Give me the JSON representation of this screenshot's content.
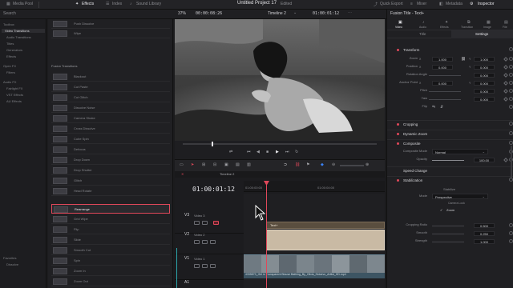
{
  "topbar": {
    "media_pool": "Media Pool",
    "effects": "Effects",
    "index": "Index",
    "sound_library": "Sound Library",
    "project_title": "Untitled Project 17",
    "edited": "Edited",
    "quick_export": "Quick Export",
    "mixer": "Mixer",
    "metadata": "Metadata",
    "inspector": "Inspector"
  },
  "viewer_bar": {
    "zoom": "37%",
    "source_tc": "00:00:08:26",
    "timeline_name": "Timeline 2",
    "record_tc": "01:00:01:12",
    "clip_name": "Fusion Title - Text+"
  },
  "left_panel": {
    "search_label": "Search",
    "items": [
      "Toolbox",
      "Video Transitions",
      "Audio Transitions",
      "Titles",
      "Generators",
      "Effects",
      "Open FX",
      "Filters",
      "Audio FX",
      "Fairlight FX",
      "VST Effects",
      "AU Effects",
      "Favorites",
      "Dissolve"
    ]
  },
  "effects_list": {
    "section_header": "Fusion Transitions",
    "items": [
      "Push Dissolve",
      "Wipe",
      "",
      "Fusion Transitions",
      "Blackout",
      "Cut Paste",
      "Cut Glitch",
      "Dissolve Noise",
      "Camera Shake",
      "Cross Dissolve",
      "Cube Spin",
      "Defocus",
      "Drop Down",
      "Drop Shutter",
      "Glitch",
      "Head Rotate",
      "Rearrange",
      "Grid Wipe",
      "Flip",
      "Slide",
      "Smooth Cut",
      "Spin",
      "Zoom In",
      "Zoom Out"
    ],
    "selected": "Rearrange"
  },
  "timeline": {
    "tab_label": "Timeline 2",
    "timecode": "01:00:01:12",
    "ruler_marks": [
      "01:00:00:00",
      "01:00:04:00"
    ],
    "tracks": [
      {
        "id": "V3",
        "name": "Video 3"
      },
      {
        "id": "V2",
        "name": "Video 2"
      },
      {
        "id": "V1",
        "name": "Video 1"
      },
      {
        "id": "A1",
        "name": "Audio 1"
      }
    ],
    "clips": {
      "v3_title": "Text+",
      "v1_filename": "4335873_Girl in Transparent Blouse Bathing_By_Olivia_Sidoevo_Artlist_HD.mp4"
    }
  },
  "inspector": {
    "tabs": [
      "Video",
      "Audio",
      "Effects",
      "Transition",
      "Image",
      "File"
    ],
    "subtabs": [
      "Title",
      "Settings"
    ],
    "transform": {
      "label": "Transform",
      "zoom": {
        "label": "Zoom",
        "x": "1.000",
        "y": "1.000"
      },
      "position": {
        "label": "Position",
        "x": "0.000",
        "y": "0.000"
      },
      "rotation_angle": {
        "label": "Rotation Angle",
        "value": "0.000"
      },
      "anchor_point": {
        "label": "Anchor Point",
        "x": "0.000",
        "y": "0.000"
      },
      "pitch": {
        "label": "Pitch",
        "value": "0.000"
      },
      "yaw": {
        "label": "Yaw",
        "value": "0.000"
      },
      "flip": {
        "label": "Flip"
      }
    },
    "sections": [
      "Cropping",
      "Dynamic Zoom",
      "Composite",
      "Speed Change",
      "Stabilization"
    ],
    "composite": {
      "mode_label": "Composite Mode",
      "mode_value": "Normal",
      "opacity_label": "Opacity",
      "opacity_value": "100.00"
    },
    "stabilization": {
      "stabilize_label": "Stabilize",
      "mode_label": "Mode",
      "mode_value": "Perspective",
      "camera_lock_label": "Camera Lock",
      "zoom_label": "Zoom",
      "cropping_ratio_label": "Cropping Ratio",
      "cropping_ratio_value": "0.500",
      "smooth_label": "Smooth",
      "smooth_value": "0.250",
      "strength_label": "Strength",
      "strength_value": "1.000"
    }
  },
  "colors": {
    "accent": "#e0485a",
    "selection": "#e0485a",
    "title_clip": "#c9baa4",
    "video_clip": "#5d7a8a",
    "playhead": "#e0485a"
  }
}
